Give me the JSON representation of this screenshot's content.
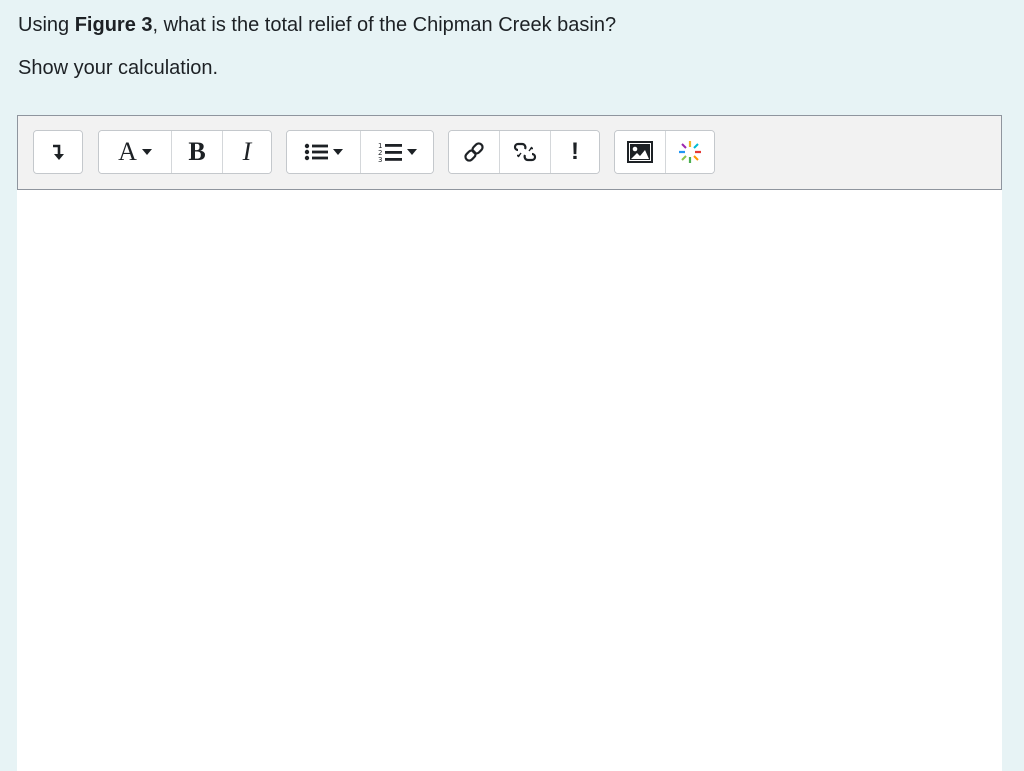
{
  "question": {
    "prefix": "Using ",
    "figure_ref": "Figure 3",
    "suffix": ", what is the total relief of the Chipman Creek basin?",
    "instruction": "Show your calculation."
  },
  "toolbar": {
    "groups": [
      {
        "buttons": [
          {
            "icon": "collapse-arrow-icon"
          }
        ]
      },
      {
        "buttons": [
          {
            "label": "A",
            "icon": "font-style-dropdown"
          },
          {
            "label": "B",
            "icon": "bold-icon"
          },
          {
            "label": "I",
            "icon": "italic-icon"
          }
        ]
      },
      {
        "buttons": [
          {
            "icon": "unordered-list-icon"
          },
          {
            "icon": "ordered-list-icon"
          }
        ]
      },
      {
        "buttons": [
          {
            "icon": "link-icon"
          },
          {
            "icon": "unlink-icon"
          },
          {
            "label": "!",
            "icon": "no-autolink-icon"
          }
        ]
      },
      {
        "buttons": [
          {
            "icon": "image-icon"
          },
          {
            "icon": "media-sparkle-icon"
          }
        ]
      }
    ]
  },
  "editor": {
    "content": ""
  },
  "colors": {
    "page_background": "#e7f3f5",
    "toolbar_background": "#f2f2f2",
    "editor_background": "#ffffff",
    "text": "#1d2125"
  }
}
